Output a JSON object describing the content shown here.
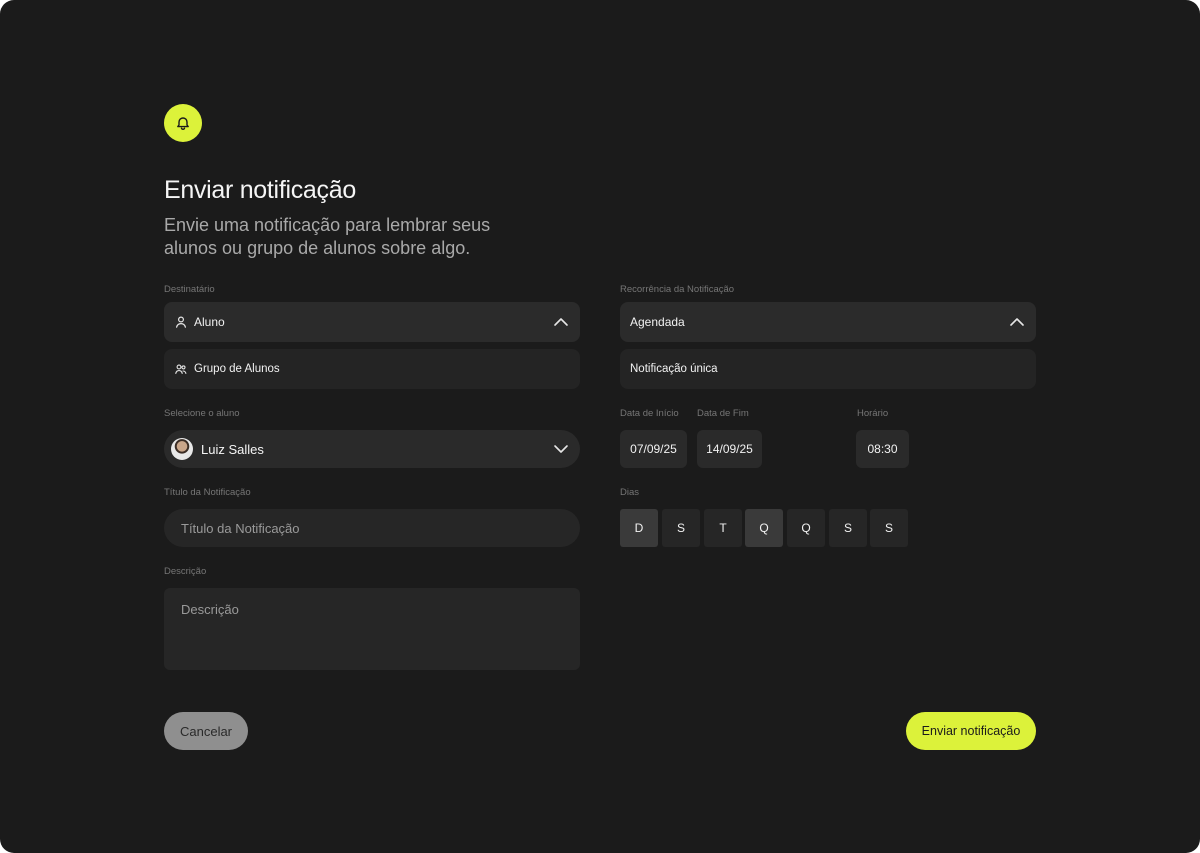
{
  "header": {
    "icon": "bell-icon",
    "title": "Enviar notificação",
    "subtitle": "Envie uma notificação para lembrar seus alunos ou grupo de alunos sobre algo."
  },
  "recipient": {
    "label": "Destinatário",
    "selected": "Aluno",
    "selected_icon": "user-icon",
    "expanded_icon": "chevron-up-icon",
    "options": [
      {
        "label": "Grupo de Alunos",
        "icon": "users-icon"
      }
    ]
  },
  "student": {
    "label": "Selecione o aluno",
    "selected": "Luiz Salles",
    "icon": "chevron-down-icon"
  },
  "notification_title": {
    "label": "Título da Notificação",
    "placeholder": "Título da Notificação"
  },
  "description": {
    "label": "Descrição",
    "placeholder": "Descrição"
  },
  "recurrence": {
    "label": "Recorrência da Notificação",
    "selected": "Agendada",
    "options": [
      "Notificação única"
    ]
  },
  "schedule": {
    "start_label": "Data de Início",
    "start_value": "07/09/25",
    "end_label": "Data de Fim",
    "end_value": "14/09/25",
    "time_label": "Horário",
    "time_value": "08:30"
  },
  "days": {
    "label": "Dias",
    "items": [
      {
        "label": "D",
        "selected": true
      },
      {
        "label": "S",
        "selected": false
      },
      {
        "label": "T",
        "selected": false
      },
      {
        "label": "Q",
        "selected": true
      },
      {
        "label": "Q",
        "selected": false
      },
      {
        "label": "S",
        "selected": false
      },
      {
        "label": "S",
        "selected": false
      }
    ]
  },
  "actions": {
    "cancel": "Cancelar",
    "submit": "Enviar notificação"
  },
  "colors": {
    "background": "#1b1b1b",
    "accent": "#dcf23a",
    "field": "#2b2b2b"
  }
}
